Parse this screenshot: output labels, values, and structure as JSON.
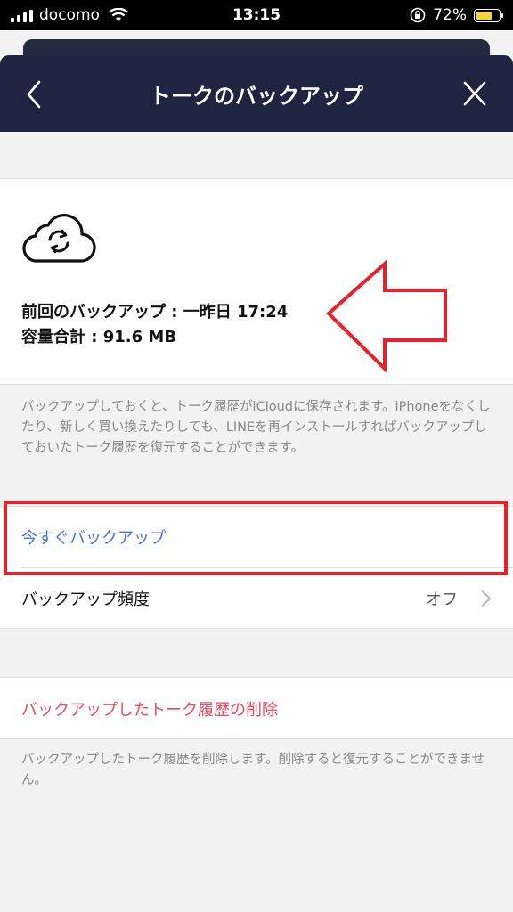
{
  "status_bar": {
    "carrier": "docomo",
    "time": "13:15",
    "battery": "72%",
    "battery_color": "#f5d33a"
  },
  "header": {
    "title": "トークのバックアップ",
    "back_icon": "chevron-left-icon",
    "close_icon": "close-icon"
  },
  "backup_info": {
    "icon": "cloud-sync-icon",
    "last_backup": "前回のバックアップ : 一昨日 17:24",
    "total_size": "容量合計 : 91.6 MB"
  },
  "description": "バックアップしておくと、トーク履歴がiCloudに保存されます。iPhoneをなくしたり、新しく買い換えたりしても、LINEを再インストールすればバックアップしておいたトーク履歴を復元することができます。",
  "actions": {
    "backup_now": "今すぐバックアップ",
    "frequency_label": "バックアップ頻度",
    "frequency_value": "オフ"
  },
  "delete": {
    "label": "バックアップしたトーク履歴の削除",
    "description": "バックアップしたトーク履歴を削除します。削除すると復元することができません。"
  },
  "colors": {
    "header": "#1f2540",
    "link": "#4a72d8",
    "danger": "#e84a5f",
    "annotation": "#e8212b"
  }
}
